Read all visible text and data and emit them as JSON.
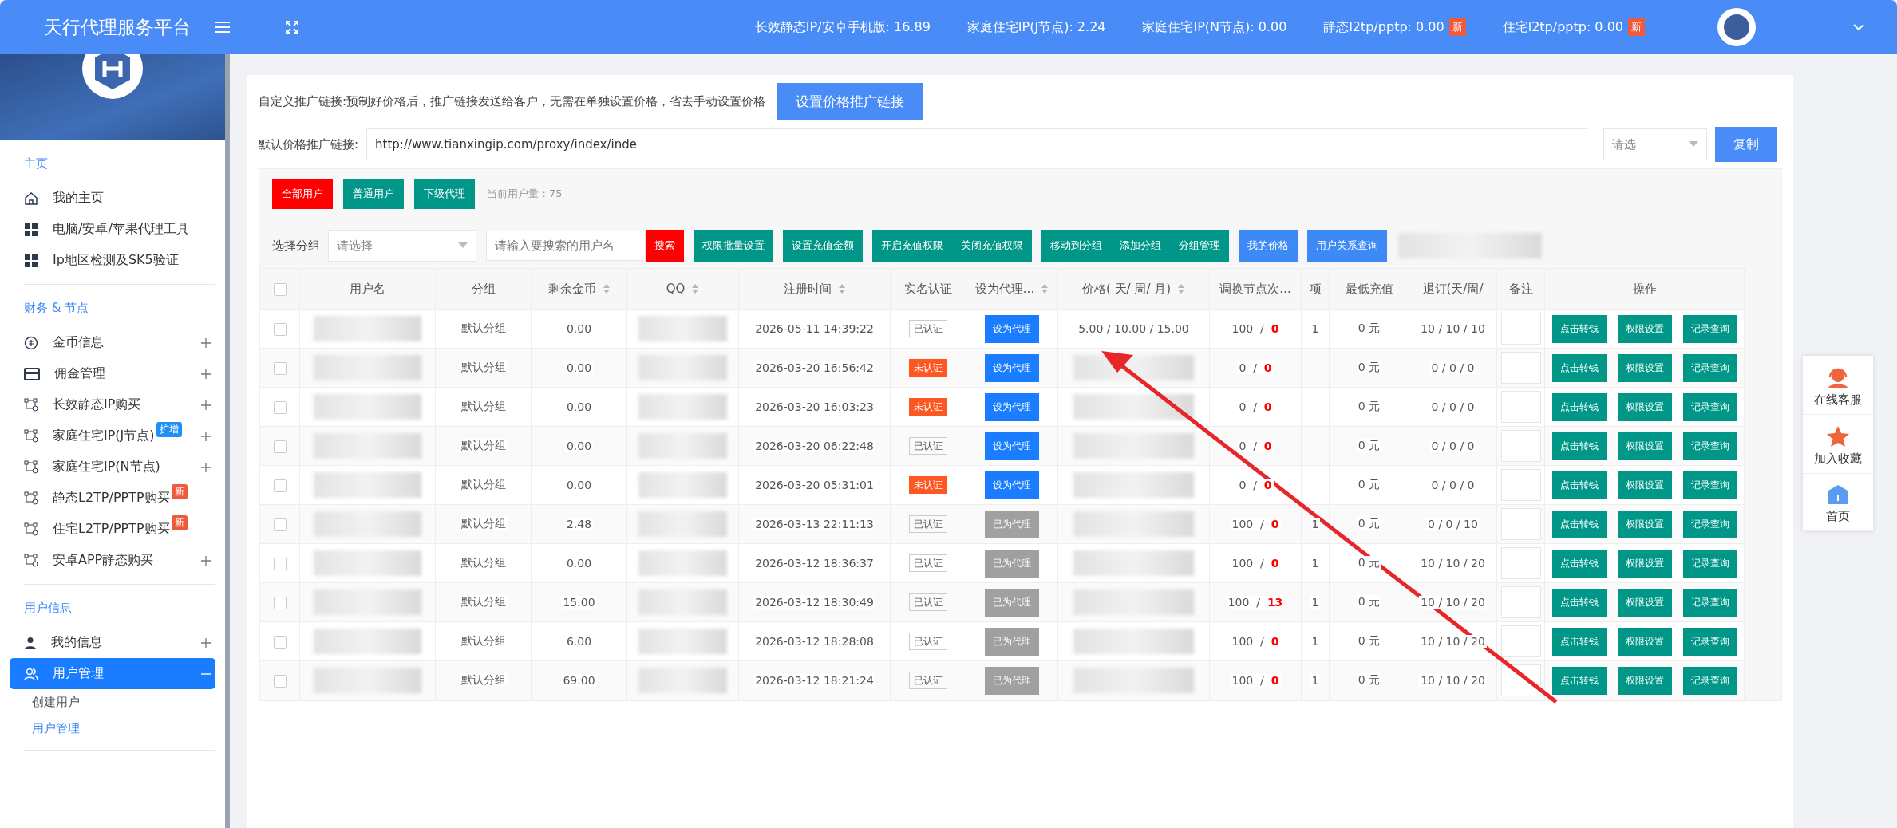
{
  "topbar": {
    "title": "天行代理服务平台",
    "stats": [
      {
        "label": "长效静态IP/安卓手机版: 16.89"
      },
      {
        "label": "家庭住宅IP(J节点): 2.24"
      },
      {
        "label": "家庭住宅IP(N节点): 0.00"
      },
      {
        "label": "静态l2tp/pptp: 0.00",
        "badge": "新"
      },
      {
        "label": "住宅l2tp/pptp: 0.00",
        "badge": "新"
      }
    ]
  },
  "sidebar": {
    "sections": [
      {
        "title": "主页",
        "items": [
          {
            "label": "我的主页",
            "selected": false
          },
          {
            "label": "电脑/安卓/苹果代理工具",
            "selected": false
          },
          {
            "label": "Ip地区检测及SK5验证",
            "selected": false
          }
        ]
      },
      {
        "title": "财务 & 节点",
        "items": [
          {
            "label": "金币信息",
            "selected": false,
            "expanded": false
          },
          {
            "label": "佣金管理",
            "selected": false,
            "expanded": false
          },
          {
            "label": "长效静态IP购买",
            "selected": false,
            "expanded": false
          },
          {
            "label": "家庭住宅IP(J节点)",
            "selected": false,
            "expanded": false,
            "badge": {
              "label": "扩增",
              "color": "#1e8ff5"
            }
          },
          {
            "label": "家庭住宅IP(N节点)",
            "selected": false,
            "expanded": false
          },
          {
            "label": "静态L2TP/PPTP购买",
            "selected": false,
            "badge": {
              "label": "新",
              "color": "#f05a3c"
            }
          },
          {
            "label": "住宅L2TP/PPTP购买",
            "selected": false,
            "badge": {
              "label": "新",
              "color": "#f05a3c"
            }
          },
          {
            "label": "安卓APP静态购买",
            "selected": false,
            "expanded": false
          }
        ]
      },
      {
        "title": "用户信息",
        "items": [
          {
            "label": "我的信息",
            "selected": false,
            "expanded": false
          },
          {
            "label": "用户管理",
            "expanded": true,
            "selected": true,
            "children": [
              {
                "label": "创建用户",
                "selected": false
              },
              {
                "label": "用户管理",
                "selected": true
              }
            ]
          }
        ]
      }
    ]
  },
  "promo": {
    "text": "自定义推广链接:预制好价格后，推广链接发送给客户，无需在单独设置价格，省去手动设置价格",
    "button": "设置价格推广链接",
    "link_label": "默认价格推广链接:",
    "link_value": "http://www.tianxingip.com/proxy/index/inde",
    "select_placeholder": "请选",
    "copy_button": "复制"
  },
  "filters": [
    {
      "label": "全部用户",
      "selected": true
    },
    {
      "label": "普通用户",
      "selected": false
    },
    {
      "label": "下级代理",
      "selected": false
    }
  ],
  "user_count": "当前用户量：75",
  "toolbar": {
    "group_label": "选择分组",
    "group_placeholder": "请选择",
    "search_placeholder": "请输入要搜索的用户名",
    "buttons": [
      [
        {
          "label": "搜索",
          "kind": "danger"
        }
      ],
      [
        {
          "label": "权限批量设置",
          "kind": "teal"
        }
      ],
      [
        {
          "label": "设置充值金额",
          "kind": "teal"
        }
      ],
      [
        {
          "label": "开启充值权限",
          "kind": "teal"
        },
        {
          "label": "关闭充值权限",
          "kind": "teal"
        }
      ],
      [
        {
          "label": "移动到分组",
          "kind": "teal"
        },
        {
          "label": "添加分组",
          "kind": "teal"
        },
        {
          "label": "分组管理",
          "kind": "teal"
        }
      ],
      [
        {
          "label": "我的价格",
          "kind": "blue"
        }
      ],
      [
        {
          "label": "用户关系查询",
          "kind": "blue"
        }
      ]
    ]
  },
  "table": {
    "all_checked": false,
    "columns": [
      {
        "label": "用户名",
        "sortable": false
      },
      {
        "label": "分组",
        "sortable": false
      },
      {
        "label": "剩余金币",
        "sortable": true
      },
      {
        "label": "QQ",
        "sortable": true
      },
      {
        "label": "注册时间",
        "sortable": true
      },
      {
        "label": "实名认证",
        "sortable": false
      },
      {
        "label": "设为代理...",
        "sortable": true
      },
      {
        "label": "价格( 天/ 周/ 月)",
        "sortable": true
      },
      {
        "label": "调换节点次...",
        "sortable": false
      },
      {
        "label": "项",
        "sortable": false
      },
      {
        "label": "最低充值",
        "sortable": false
      },
      {
        "label": "退订(天/周/",
        "sortable": false
      },
      {
        "label": "备注",
        "sortable": false
      },
      {
        "label": "操作",
        "sortable": false
      }
    ],
    "rows": [
      {
        "checked": false,
        "group": "默认分组",
        "coins": "0.00",
        "registered": "2026-05-11 14:39:22",
        "auth": {
          "label": "已认证",
          "verified": true
        },
        "agent": {
          "label": "设为代理",
          "is_agent": false
        },
        "price": "5.00 /  10.00 /  15.00",
        "swaps": "100  /  **0**",
        "item": "1",
        "min_recharge": "0 元",
        "refund": "10 / 10 / 10",
        "actions": [
          "点击转钱",
          "权限设置",
          "记录查询"
        ]
      },
      {
        "checked": false,
        "group": "默认分组",
        "coins": "0.00",
        "registered": "2026-03-20 16:56:42",
        "auth": {
          "label": "未认证",
          "verified": false
        },
        "agent": {
          "label": "设为代理",
          "is_agent": false
        },
        "swaps": "0  /  **0**",
        "min_recharge": "0 元",
        "refund": "0 / 0 / 0",
        "actions": [
          "点击转钱",
          "权限设置",
          "记录查询"
        ]
      },
      {
        "checked": false,
        "group": "默认分组",
        "coins": "0.00",
        "registered": "2026-03-20 16:03:23",
        "auth": {
          "label": "未认证",
          "verified": false
        },
        "agent": {
          "label": "设为代理",
          "is_agent": false
        },
        "swaps": "0  /  **0**",
        "min_recharge": "0 元",
        "refund": "0 / 0 / 0",
        "actions": [
          "点击转钱",
          "权限设置",
          "记录查询"
        ]
      },
      {
        "checked": false,
        "group": "默认分组",
        "coins": "0.00",
        "registered": "2026-03-20 06:22:48",
        "auth": {
          "label": "已认证",
          "verified": true
        },
        "agent": {
          "label": "设为代理",
          "is_agent": false
        },
        "swaps": "0  /  **0**",
        "min_recharge": "0 元",
        "refund": "0 / 0 / 0",
        "actions": [
          "点击转钱",
          "权限设置",
          "记录查询"
        ]
      },
      {
        "checked": false,
        "group": "默认分组",
        "coins": "0.00",
        "registered": "2026-03-20 05:31:01",
        "auth": {
          "label": "未认证",
          "verified": false
        },
        "agent": {
          "label": "设为代理",
          "is_agent": false
        },
        "swaps": "0  /  **0**",
        "min_recharge": "0 元",
        "refund": "0 / 0 / 0",
        "actions": [
          "点击转钱",
          "权限设置",
          "记录查询"
        ]
      },
      {
        "checked": false,
        "group": "默认分组",
        "coins": "2.48",
        "registered": "2026-03-13 22:11:13",
        "auth": {
          "label": "已认证",
          "verified": true
        },
        "agent": {
          "label": "已为代理",
          "is_agent": true
        },
        "swaps": "100  /  **0**",
        "item": "1",
        "min_recharge": "0 元",
        "refund": "0 / 0 / 10",
        "actions": [
          "点击转钱",
          "权限设置",
          "记录查询"
        ]
      },
      {
        "checked": false,
        "group": "默认分组",
        "coins": "0.00",
        "registered": "2026-03-12 18:36:37",
        "auth": {
          "label": "已认证",
          "verified": true
        },
        "agent": {
          "label": "已为代理",
          "is_agent": true
        },
        "swaps": "100  /  **0**",
        "item": "1",
        "min_recharge": "0 元",
        "refund": "10 / 10 / 20",
        "actions": [
          "点击转钱",
          "权限设置",
          "记录查询"
        ]
      },
      {
        "checked": false,
        "group": "默认分组",
        "coins": "15.00",
        "registered": "2026-03-12 18:30:49",
        "auth": {
          "label": "已认证",
          "verified": true
        },
        "agent": {
          "label": "已为代理",
          "is_agent": true
        },
        "swaps": "100  /  **13**",
        "item": "1",
        "min_recharge": "0 元",
        "refund": "10 / 10 / 20",
        "actions": [
          "点击转钱",
          "权限设置",
          "记录查询"
        ]
      },
      {
        "checked": false,
        "group": "默认分组",
        "coins": "6.00",
        "registered": "2026-03-12 18:28:08",
        "auth": {
          "label": "已认证",
          "verified": true
        },
        "agent": {
          "label": "已为代理",
          "is_agent": true
        },
        "swaps": "100  /  **0**",
        "item": "1",
        "min_recharge": "0 元",
        "refund": "10 / 10 / 20",
        "actions": [
          "点击转钱",
          "权限设置",
          "记录查询"
        ]
      },
      {
        "checked": false,
        "group": "默认分组",
        "coins": "69.00",
        "registered": "2026-03-12 18:21:24",
        "auth": {
          "label": "已认证",
          "verified": true
        },
        "agent": {
          "label": "已为代理",
          "is_agent": true
        },
        "swaps": "100  /  **0**",
        "item": "1",
        "min_recharge": "0 元",
        "refund": "10 / 10 / 20",
        "actions": [
          "点击转钱",
          "权限设置",
          "记录查询"
        ]
      }
    ]
  },
  "float_panel": [
    {
      "label": "在线客服"
    },
    {
      "label": "加入收藏"
    },
    {
      "label": "首页"
    }
  ]
}
